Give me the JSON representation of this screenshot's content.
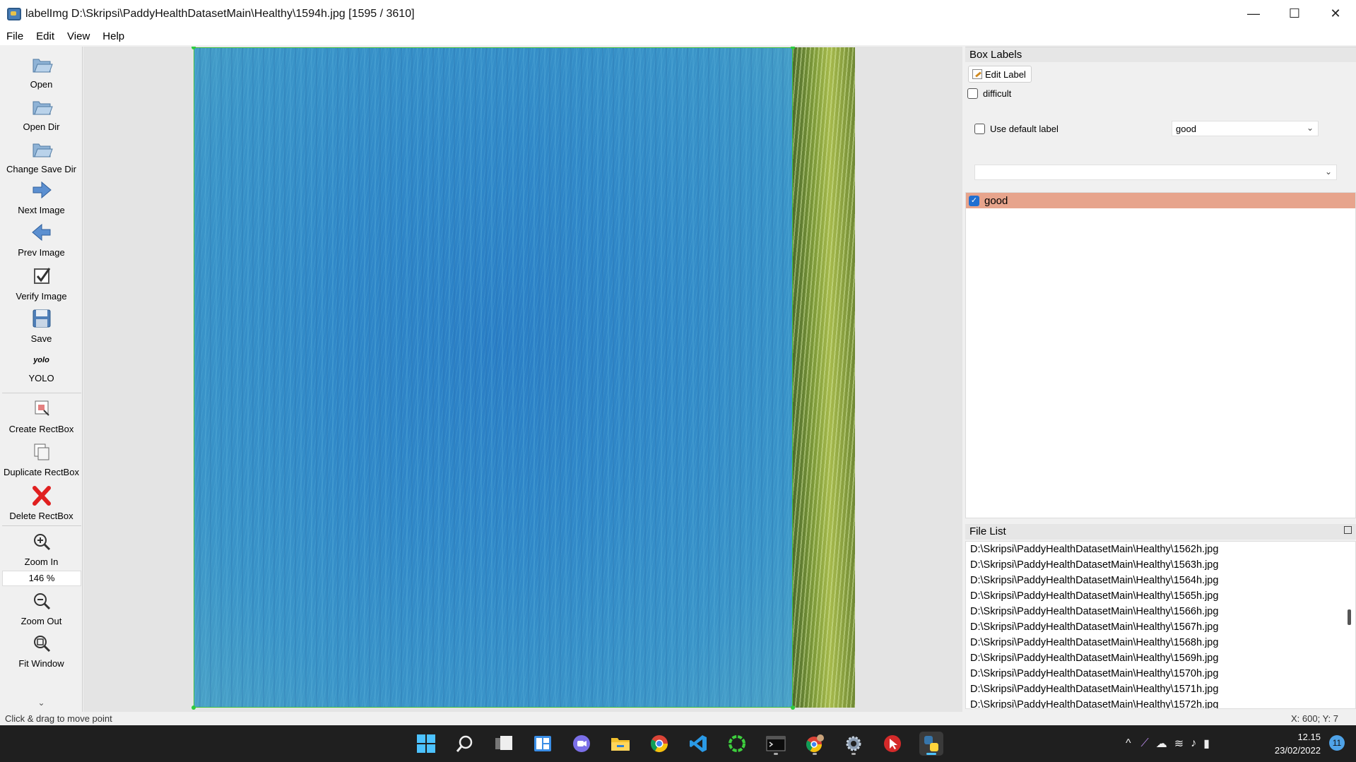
{
  "window": {
    "title": "labelImg D:\\Skripsi\\PaddyHealthDatasetMain\\Healthy\\1594h.jpg [1595 / 3610]",
    "minimize": "—",
    "maximize": "☐",
    "close": "✕"
  },
  "menu": [
    "File",
    "Edit",
    "View",
    "Help"
  ],
  "toolbar": {
    "open": "Open",
    "open_dir": "Open Dir",
    "change_save_dir": "Change Save Dir",
    "next_image": "Next Image",
    "prev_image": "Prev Image",
    "verify_image": "Verify Image",
    "save": "Save",
    "format_icon_text": "yolo",
    "format": "YOLO",
    "create_rectbox": "Create RectBox",
    "duplicate_rectbox": "Duplicate RectBox",
    "delete_rectbox": "Delete RectBox",
    "zoom_in": "Zoom In",
    "zoom_value": "146 %",
    "zoom_out": "Zoom Out",
    "fit_window": "Fit Window"
  },
  "box_labels": {
    "title": "Box Labels",
    "edit_label": "Edit Label",
    "difficult": "difficult",
    "use_default_label": "Use default label",
    "default_label_value": "good",
    "labels": [
      {
        "text": "good",
        "checked": true
      }
    ]
  },
  "file_list": {
    "title": "File List",
    "items": [
      "D:\\Skripsi\\PaddyHealthDatasetMain\\Healthy\\1562h.jpg",
      "D:\\Skripsi\\PaddyHealthDatasetMain\\Healthy\\1563h.jpg",
      "D:\\Skripsi\\PaddyHealthDatasetMain\\Healthy\\1564h.jpg",
      "D:\\Skripsi\\PaddyHealthDatasetMain\\Healthy\\1565h.jpg",
      "D:\\Skripsi\\PaddyHealthDatasetMain\\Healthy\\1566h.jpg",
      "D:\\Skripsi\\PaddyHealthDatasetMain\\Healthy\\1567h.jpg",
      "D:\\Skripsi\\PaddyHealthDatasetMain\\Healthy\\1568h.jpg",
      "D:\\Skripsi\\PaddyHealthDatasetMain\\Healthy\\1569h.jpg",
      "D:\\Skripsi\\PaddyHealthDatasetMain\\Healthy\\1570h.jpg",
      "D:\\Skripsi\\PaddyHealthDatasetMain\\Healthy\\1571h.jpg",
      "D:\\Skripsi\\PaddyHealthDatasetMain\\Healthy\\1572h.jpg"
    ]
  },
  "status": {
    "message": "Click & drag to move point",
    "coords": "X: 600; Y: 7"
  },
  "taskbar": {
    "time": "12.15",
    "date": "23/02/2022",
    "notifications": "11"
  },
  "colors": {
    "label_highlight": "#e7a48c",
    "bbox_outline": "#3fbf3f",
    "taskbar_bg": "#1f1f1f"
  }
}
